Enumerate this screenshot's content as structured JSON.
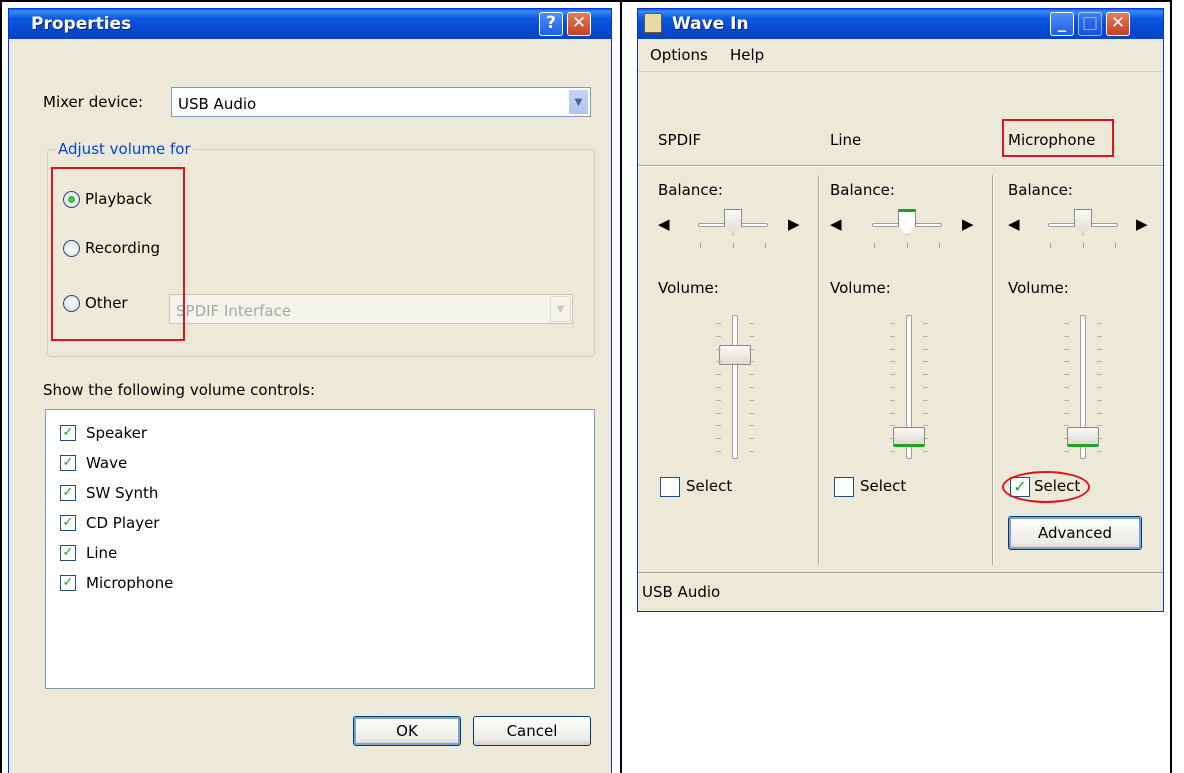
{
  "properties": {
    "title": "Properties",
    "help_glyph": "?",
    "close_glyph": "✕",
    "mixer_label": "Mixer device:",
    "mixer_value": "USB Audio",
    "adjust_legend": "Adjust volume for",
    "radios": [
      {
        "label": "Playback",
        "checked": true
      },
      {
        "label": "Recording",
        "checked": false
      },
      {
        "label": "Other",
        "checked": false
      }
    ],
    "other_combo": "SPDIF Interface",
    "show_label": "Show the following volume controls:",
    "controls": [
      {
        "label": "Speaker",
        "checked": true
      },
      {
        "label": "Wave",
        "checked": true
      },
      {
        "label": "SW Synth",
        "checked": true
      },
      {
        "label": "CD Player",
        "checked": true
      },
      {
        "label": "Line",
        "checked": true
      },
      {
        "label": "Microphone",
        "checked": true
      }
    ],
    "ok_label": "OK",
    "cancel_label": "Cancel"
  },
  "wave": {
    "title": "Wave In",
    "menu": [
      "Options",
      "Help"
    ],
    "channels": [
      {
        "name": "SPDIF",
        "balance_label": "Balance:",
        "volume_label": "Volume:",
        "select_label": "Select",
        "selected": false,
        "volume_level": 0.7
      },
      {
        "name": "Line",
        "balance_label": "Balance:",
        "volume_label": "Volume:",
        "select_label": "Select",
        "selected": false,
        "volume_level": 0.1
      },
      {
        "name": "Microphone",
        "balance_label": "Balance:",
        "volume_label": "Volume:",
        "select_label": "Select",
        "selected": true,
        "volume_level": 0.1
      }
    ],
    "advanced_label": "Advanced",
    "status": "USB Audio",
    "minimize_glyph": "_",
    "maximize_glyph": "□",
    "close_glyph": "✕"
  },
  "colors": {
    "highlight": "#e0141e",
    "xp_blue": "#0a5ee0",
    "check_green": "#21a121"
  }
}
